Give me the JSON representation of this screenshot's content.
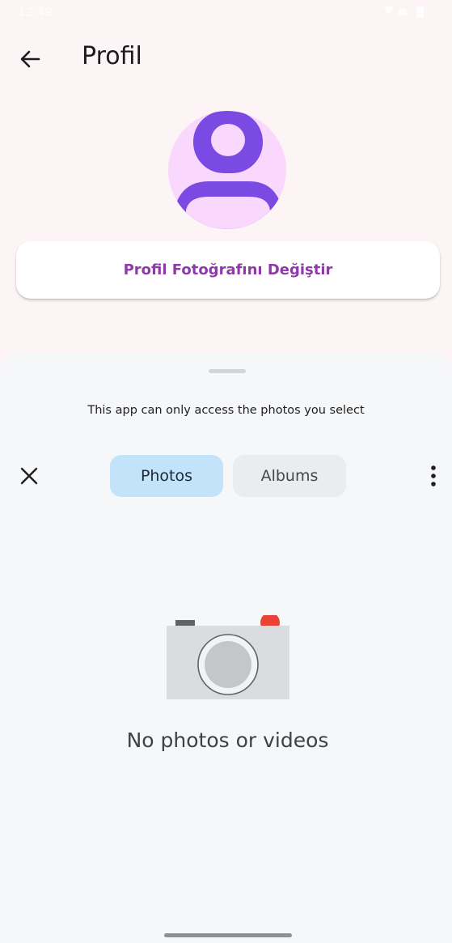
{
  "status_bar": {
    "time": "12:49"
  },
  "app_bar": {
    "title": "Profil",
    "back_icon": "arrow-back-icon"
  },
  "avatar": {
    "icon": "person-icon",
    "background_color": "#fad8fd",
    "icon_color": "#7a4ae3"
  },
  "profile_actions": {
    "change_photo_label": "Profil Fotoğrafını Değiştir",
    "label_color": "#8e3aa8"
  },
  "photo_picker": {
    "notice": "This app can only access the photos you select",
    "close_icon": "close-icon",
    "more_icon": "more-vert-icon",
    "tabs": [
      {
        "label": "Photos",
        "selected": true
      },
      {
        "label": "Albums",
        "selected": false
      }
    ],
    "empty_state": {
      "icon": "camera-icon",
      "text": "No photos or videos"
    }
  },
  "colors": {
    "accent": "#8e3aa8",
    "selected_tab": "#c3e3fb",
    "unselected_tab": "#ebecef",
    "camera_red_dot": "#ea4335"
  }
}
